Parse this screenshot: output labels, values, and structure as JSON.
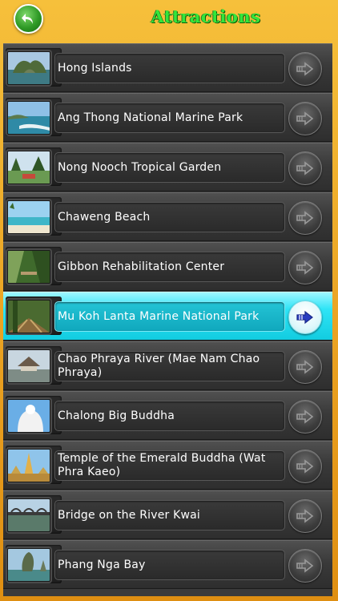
{
  "header": {
    "title": "Attractions",
    "back_icon": "back-arrow-icon"
  },
  "colors": {
    "background": "#e9a21a",
    "title": "#34e63a",
    "row": "#3a3a3a",
    "selected_row": "#12cce0",
    "back_button": "#2f9a26"
  },
  "list": {
    "items": [
      {
        "label": "Hong Islands",
        "selected": false
      },
      {
        "label": "Ang Thong National Marine Park",
        "selected": false
      },
      {
        "label": "Nong Nooch Tropical Garden",
        "selected": false
      },
      {
        "label": "Chaweng Beach",
        "selected": false
      },
      {
        "label": "Gibbon Rehabilitation Center",
        "selected": false
      },
      {
        "label": "Mu Koh Lanta Marine National Park",
        "selected": true
      },
      {
        "label": "Chao Phraya River (Mae Nam Chao Phraya)",
        "selected": false
      },
      {
        "label": "Chalong Big Buddha",
        "selected": false
      },
      {
        "label": "Temple of the Emerald Buddha (Wat Phra Kaeo)",
        "selected": false
      },
      {
        "label": "Bridge on the River Kwai",
        "selected": false
      },
      {
        "label": "Phang Nga Bay",
        "selected": false
      }
    ]
  }
}
